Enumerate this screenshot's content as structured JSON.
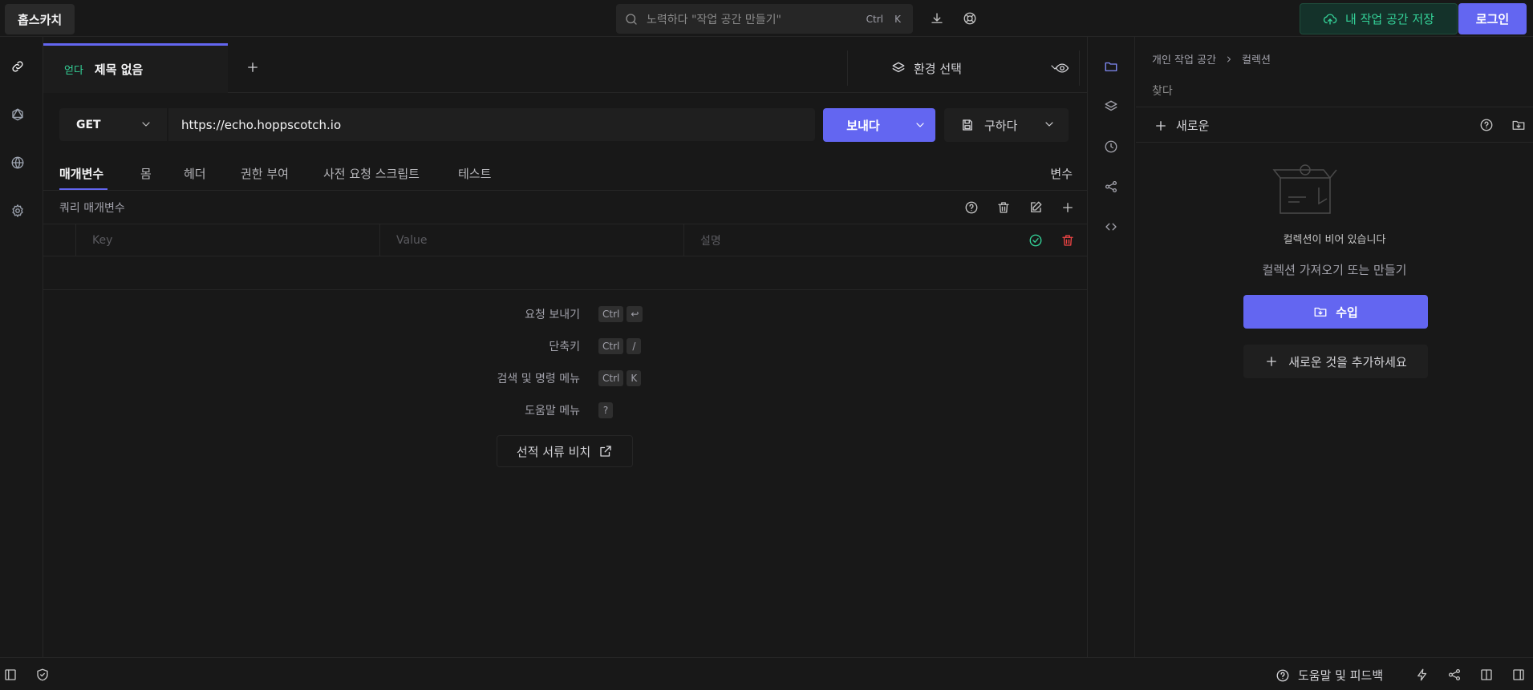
{
  "header": {
    "app_name": "홉스카치",
    "search_placeholder": "노력하다 \"작업 공간 만들기\"",
    "search_kbd": [
      "Ctrl",
      "K"
    ],
    "save_workspace": "내 작업 공간 저장",
    "login": "로그인"
  },
  "request_tab": {
    "method": "얻다",
    "title": "제목 없음"
  },
  "environment": {
    "label": "환경 선택"
  },
  "url_row": {
    "method": "GET",
    "url": "https://echo.hoppscotch.io",
    "send": "보내다",
    "save": "구하다"
  },
  "subtabs": [
    {
      "label": "매개변수",
      "active": true
    },
    {
      "label": "몸"
    },
    {
      "label": "헤더"
    },
    {
      "label": "권한 부여"
    },
    {
      "label": "사전 요청 스크립트"
    },
    {
      "label": "테스트"
    }
  ],
  "variables_link": "변수",
  "query_params": {
    "title": "쿼리 매개변수",
    "columns": {
      "key": "Key",
      "value": "Value",
      "description": "설명"
    }
  },
  "shortcuts": [
    {
      "label": "요청 보내기",
      "keys": [
        "Ctrl",
        "↩"
      ]
    },
    {
      "label": "단축키",
      "keys": [
        "Ctrl",
        "/"
      ]
    },
    {
      "label": "검색 및 명령 메뉴",
      "keys": [
        "Ctrl",
        "K"
      ]
    },
    {
      "label": "도움말 메뉴",
      "keys": [
        "?"
      ]
    }
  ],
  "docs_button": "선적 서류 비치",
  "collections": {
    "breadcrumb": [
      "개인 작업 공간",
      "컬렉션"
    ],
    "search_placeholder": "찾다",
    "new_button": "새로운",
    "empty_title": "컬렉션이 비어 있습니다",
    "empty_subtitle": "컬렉션 가져오기 또는 만들기",
    "import_button": "수입",
    "add_new_button": "새로운 것을 추가하세요"
  },
  "footer": {
    "help_feedback": "도움말 및 피드백"
  },
  "colors": {
    "accent": "#6366f1",
    "success": "#34d399",
    "danger": "#ef4444",
    "background": "#181818"
  }
}
